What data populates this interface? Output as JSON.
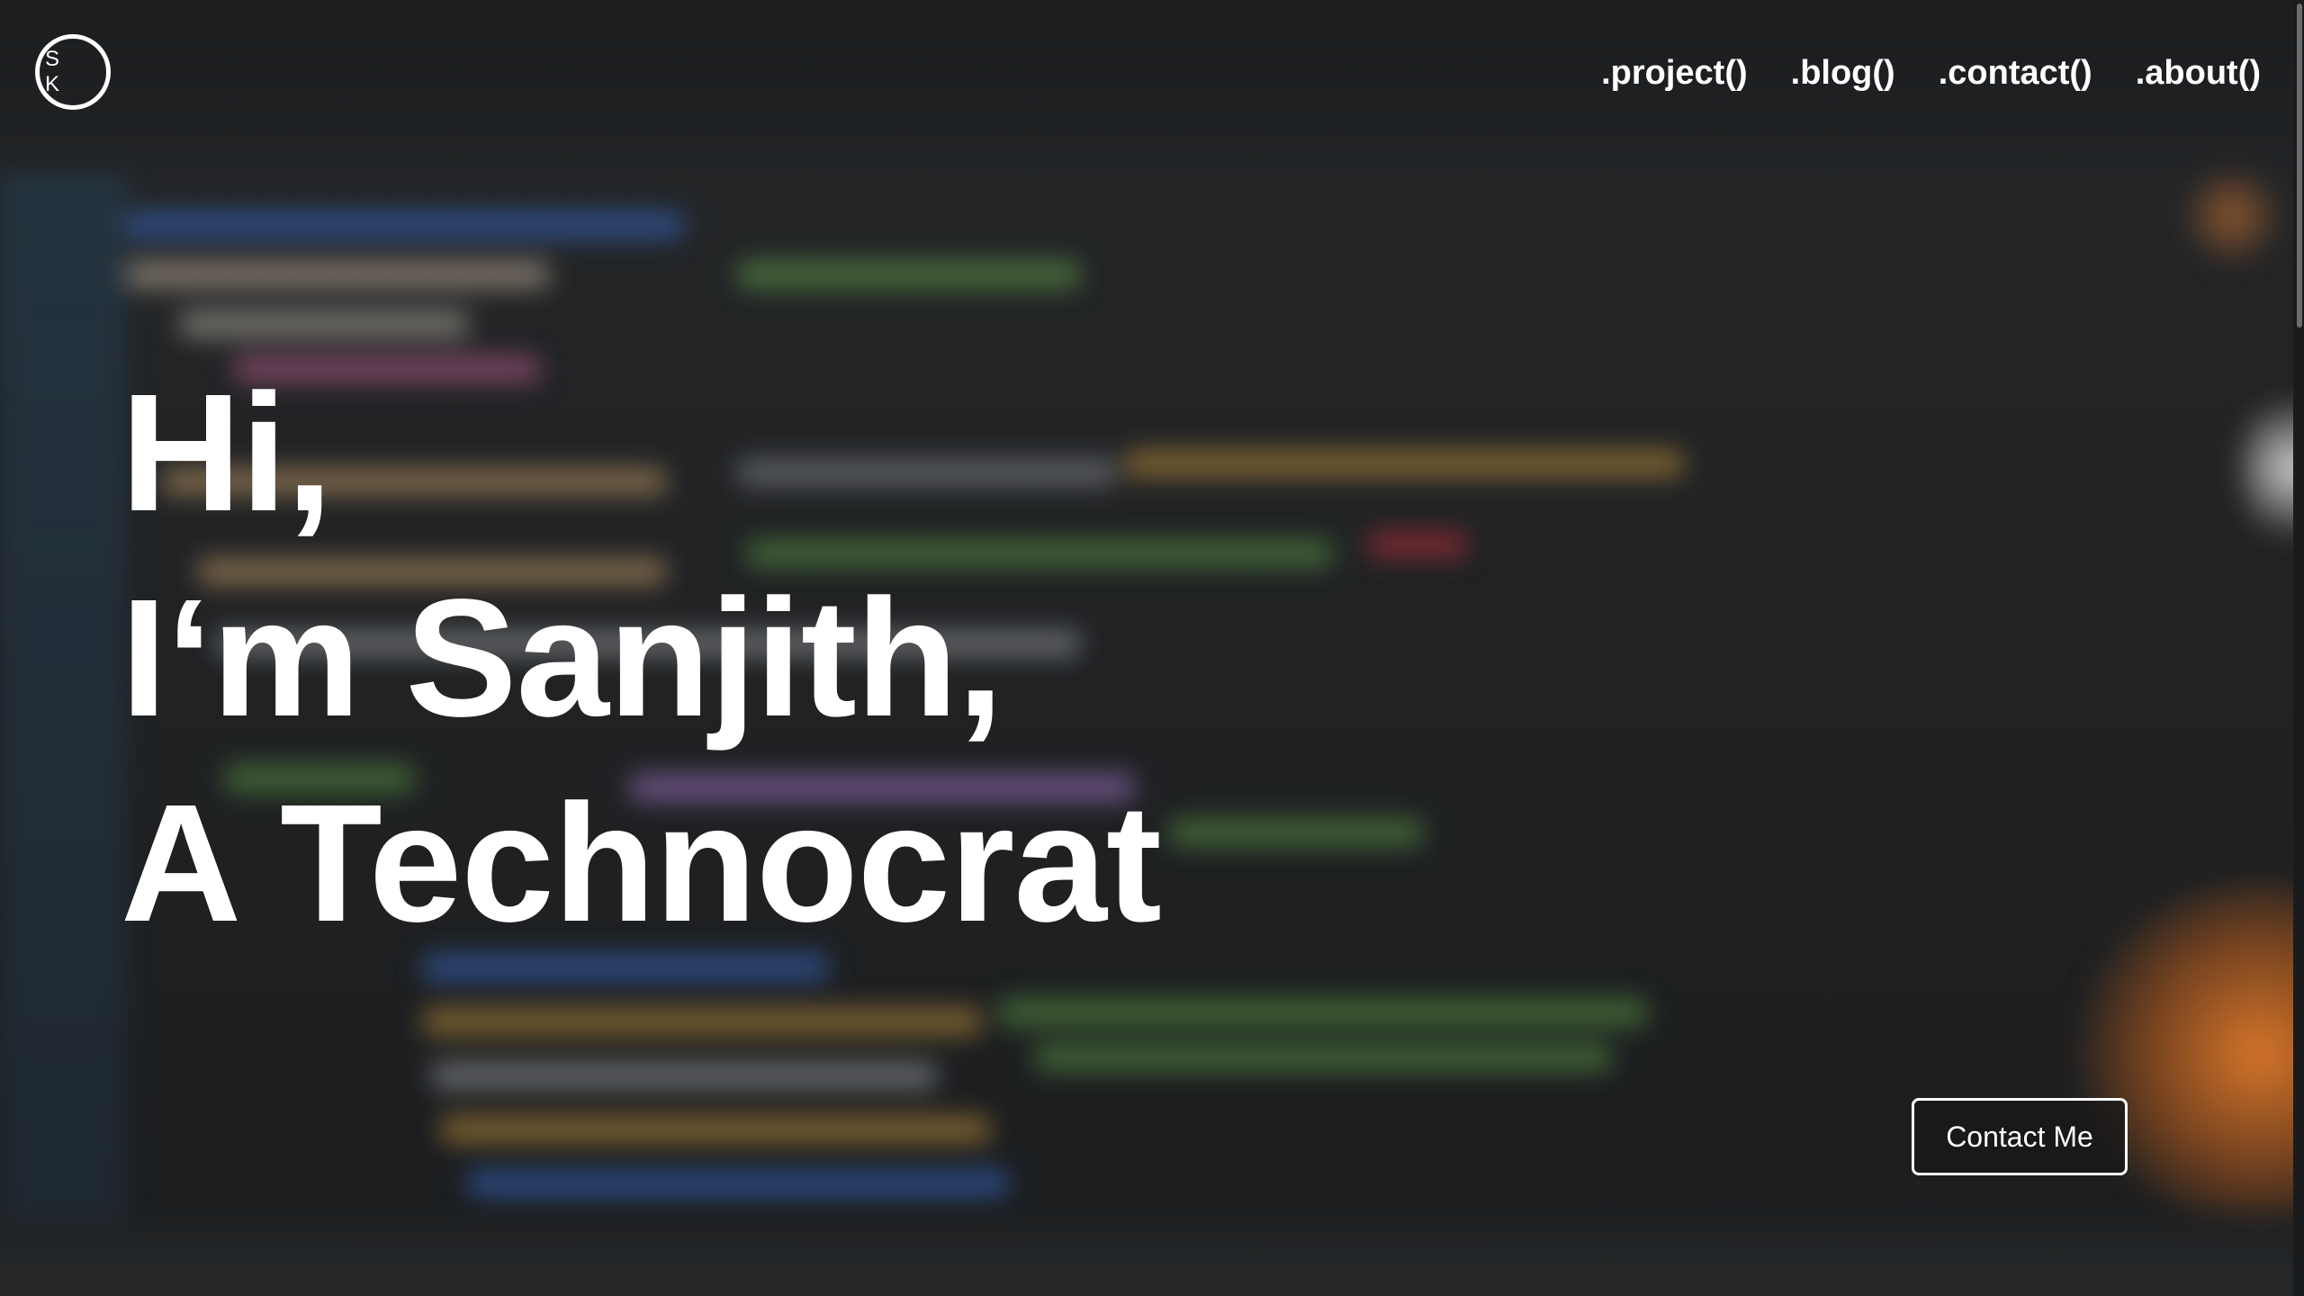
{
  "logo": {
    "initials": "S K"
  },
  "nav": {
    "items": [
      {
        "label": ".project()"
      },
      {
        "label": ".blog()"
      },
      {
        "label": ".contact()"
      },
      {
        "label": ".about()"
      }
    ]
  },
  "hero": {
    "line1": "Hi,",
    "line2": "I‘m Sanjith,",
    "line3": "A Technocrat",
    "cta_label": "Contact Me"
  },
  "colors": {
    "background": "#202224",
    "text": "#ffffff",
    "accent_glow": "#e07a2a"
  }
}
